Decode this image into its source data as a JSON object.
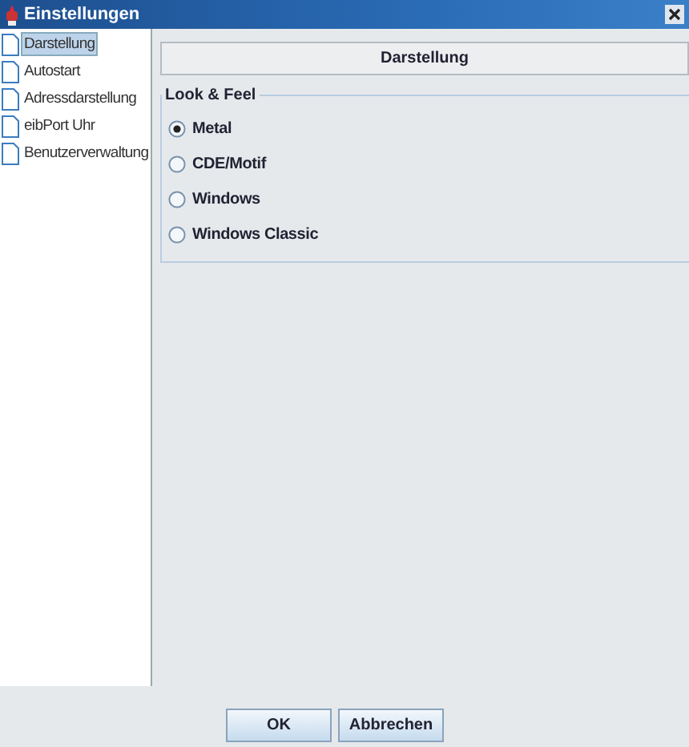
{
  "window": {
    "title": "Einstellungen"
  },
  "sidebar": {
    "items": [
      {
        "label": "Darstellung",
        "selected": true
      },
      {
        "label": "Autostart",
        "selected": false
      },
      {
        "label": "Adressdarstellung",
        "selected": false
      },
      {
        "label": "eibPort Uhr",
        "selected": false
      },
      {
        "label": "Benutzerverwaltung",
        "selected": false
      }
    ]
  },
  "panel": {
    "title": "Darstellung",
    "group": {
      "title": "Look & Feel",
      "options": [
        {
          "label": "Metal",
          "selected": true
        },
        {
          "label": "CDE/Motif",
          "selected": false
        },
        {
          "label": "Windows",
          "selected": false
        },
        {
          "label": "Windows Classic",
          "selected": false
        }
      ]
    }
  },
  "buttons": [
    "OK",
    "Abbrechen"
  ]
}
